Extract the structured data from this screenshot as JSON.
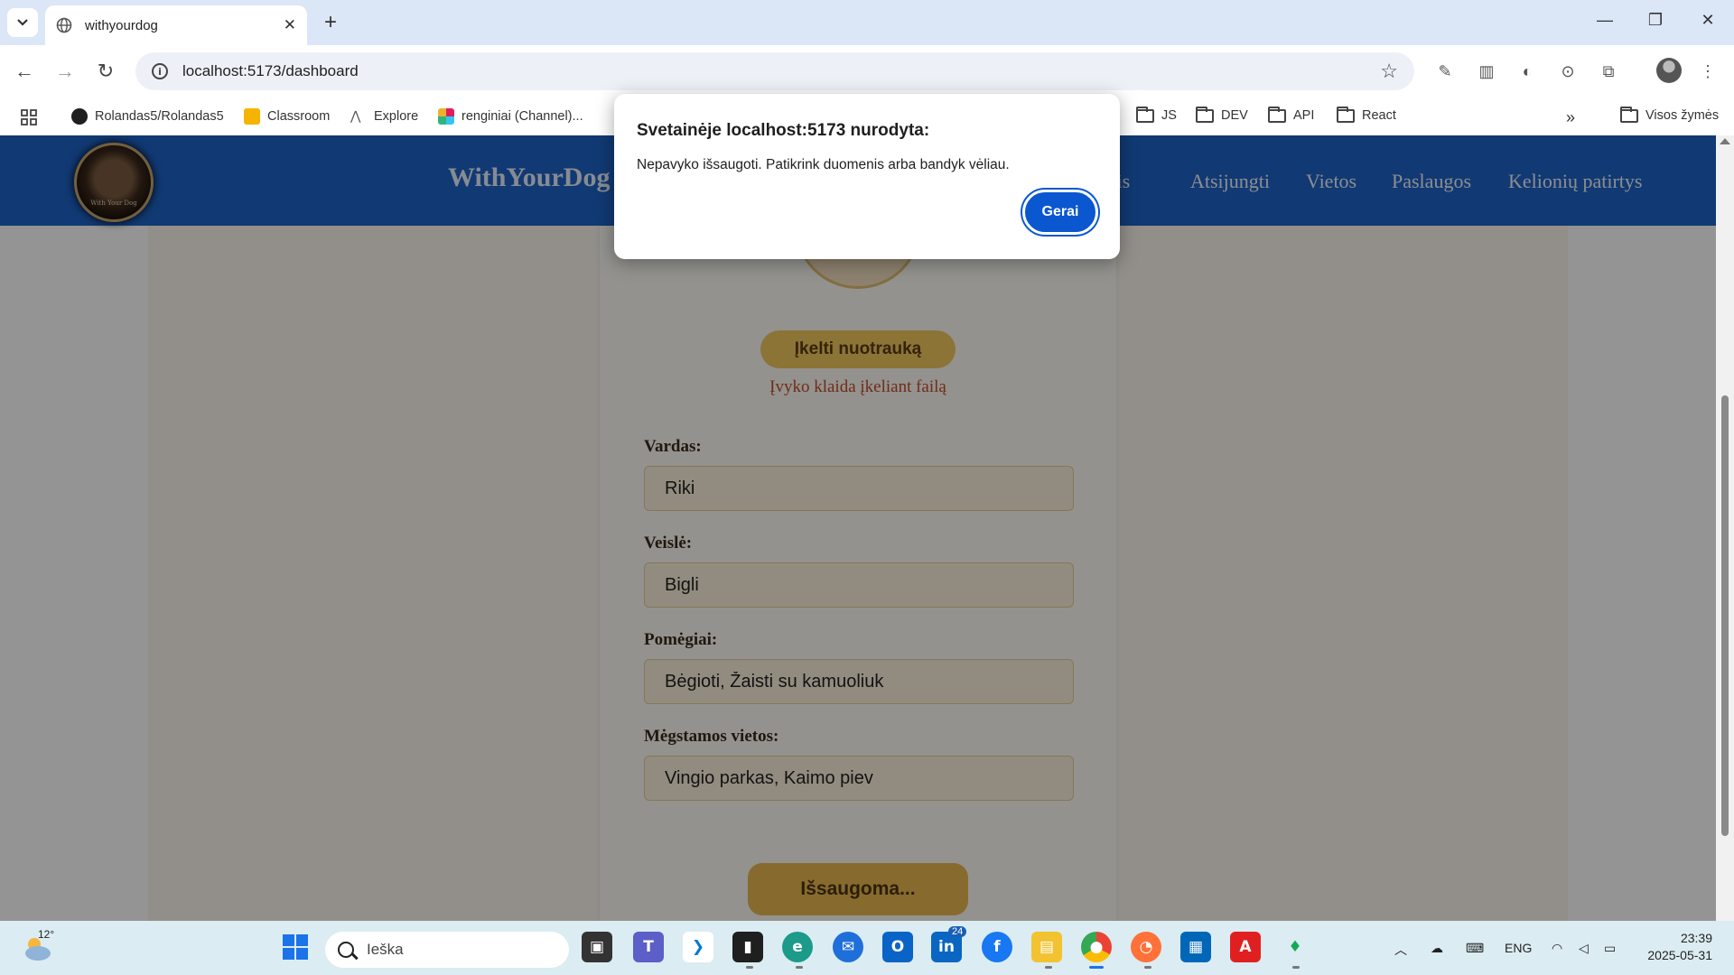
{
  "browser": {
    "tab_title": "withyourdog",
    "url": "localhost:5173/dashboard",
    "bookmarks": [
      {
        "label": "Rolandas5/Rolandas5",
        "icon": "github-icon"
      },
      {
        "label": "Classroom",
        "icon": "classroom-icon"
      },
      {
        "label": "Explore",
        "icon": "explore-icon"
      },
      {
        "label": "renginiai (Channel)...",
        "icon": "slack-icon"
      },
      {
        "label": "JS",
        "icon": "folder-icon"
      },
      {
        "label": "DEV",
        "icon": "folder-icon"
      },
      {
        "label": "API",
        "icon": "folder-icon"
      },
      {
        "label": "React",
        "icon": "folder-icon"
      }
    ],
    "all_bookmarks_label": "Visos žymės"
  },
  "site": {
    "brand": "WithYourDog",
    "logo_caption": "With Your Dog",
    "nav": [
      "ofilis",
      "Atsijungti",
      "Vietos",
      "Paslaugos",
      "Kelionių patirtys"
    ]
  },
  "profile_form": {
    "upload_button": "Įkelti nuotrauką",
    "upload_error": "Įvyko klaida įkeliant failą",
    "fields": [
      {
        "label": "Vardas:",
        "value": "Riki"
      },
      {
        "label": "Veislė:",
        "value": "Bigli"
      },
      {
        "label": "Pomėgiai:",
        "value": "Bėgioti, Žaisti su kamuoliuk"
      },
      {
        "label": "Mėgstamos vietos:",
        "value": "Vingio parkas, Kaimo piev"
      }
    ],
    "save_button": "Išsaugoma..."
  },
  "alert": {
    "title": "Svetainėje localhost:5173 nurodyta:",
    "message": "Nepavyko išsaugoti. Patikrink duomenis arba bandyk vėliau.",
    "ok_button": "Gerai"
  },
  "taskbar": {
    "weather_temp": "12°",
    "search_placeholder": "Ieška",
    "teams_badge": "24",
    "language": "ENG",
    "time": "23:39",
    "date": "2025-05-31"
  },
  "colors": {
    "header_blue": "#1e63c7",
    "accent_gold": "#f1c860",
    "error_red": "#c34a2a",
    "dialog_button": "#0b57d0"
  }
}
